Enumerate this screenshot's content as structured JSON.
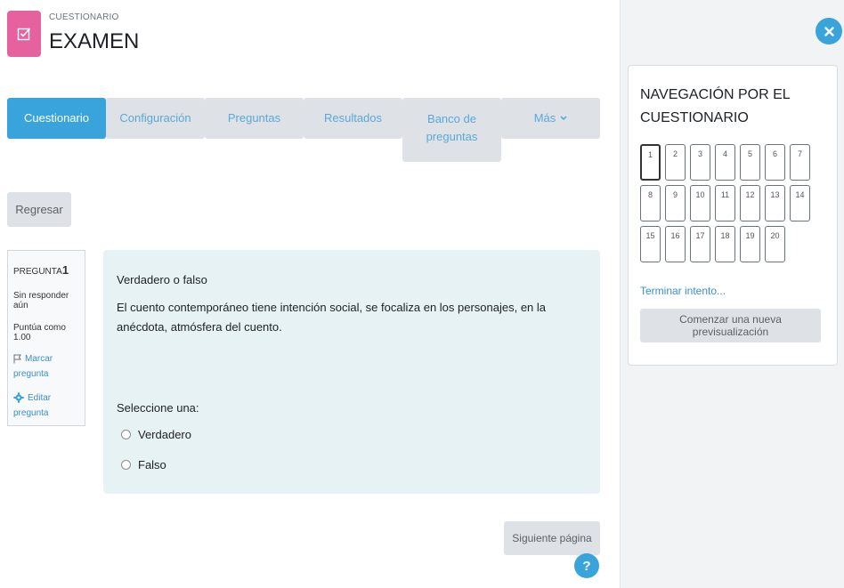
{
  "header": {
    "kicker": "CUESTIONARIO",
    "title": "EXAMEN",
    "icon": "quiz-check-icon",
    "accent": "#e5629f"
  },
  "tabs": [
    {
      "label": "Cuestionario",
      "active": true
    },
    {
      "label": "Configuración",
      "active": false
    },
    {
      "label": "Preguntas",
      "active": false
    },
    {
      "label": "Resultados",
      "active": false
    },
    {
      "label": "Banco de preguntas",
      "active": false
    },
    {
      "label": "Más",
      "active": false
    }
  ],
  "back_button": "Regresar",
  "question_info": {
    "label": "PREGUNTA",
    "number": "1",
    "status": "Sin responder aún",
    "score": "Puntúa como 1.00",
    "flag": "Marcar pregunta",
    "edit": "Editar pregunta"
  },
  "question": {
    "type": "Verdadero o falso",
    "text": "El cuento contemporáneo tiene intención social, se focaliza en los personajes, en la anécdota, atmósfera del cuento.",
    "prompt": "Seleccione una:",
    "options": [
      "Verdadero",
      "Falso"
    ]
  },
  "next_button": "Siguiente página",
  "help_label": "?",
  "drawer": {
    "title": "NAVEGACIÓN POR EL CUESTIONARIO",
    "questions": [
      "1",
      "2",
      "3",
      "4",
      "5",
      "6",
      "7",
      "8",
      "9",
      "10",
      "11",
      "12",
      "13",
      "14",
      "15",
      "16",
      "17",
      "18",
      "19",
      "20"
    ],
    "current": "1",
    "finish_link": "Terminar intento...",
    "preview_button": "Comenzar una nueva previsualización"
  },
  "colors": {
    "primary": "#39a3dc",
    "question_bg": "#e7f2f4",
    "button_bg": "#dee2e6"
  }
}
